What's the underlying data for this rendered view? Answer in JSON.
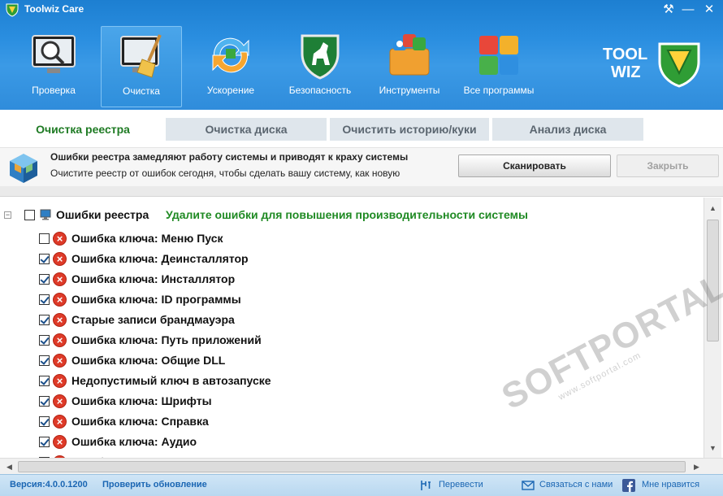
{
  "window": {
    "title": "Toolwiz Care",
    "settings_glyph": "⚒",
    "minimize_glyph": "―",
    "close_glyph": "✕"
  },
  "toolbar": {
    "items": [
      {
        "label": "Проверка",
        "icon": "magnifier-monitor-icon"
      },
      {
        "label": "Очистка",
        "icon": "broom-monitor-icon",
        "active": true
      },
      {
        "label": "Ускорение",
        "icon": "speed-arrows-icon"
      },
      {
        "label": "Безопасность",
        "icon": "shield-horse-icon"
      },
      {
        "label": "Инструменты",
        "icon": "toolbox-icon"
      },
      {
        "label": "Все программы",
        "icon": "apps-grid-icon"
      }
    ]
  },
  "brand": {
    "line1": "TOOL",
    "line2": "WIZ"
  },
  "subtabs": [
    {
      "label": "Очистка реестра",
      "active": true
    },
    {
      "label": "Очистка диска",
      "active": false
    },
    {
      "label": "Очистить историю/куки",
      "active": false
    },
    {
      "label": "Анализ диска",
      "active": false
    }
  ],
  "info": {
    "title": "Ошибки реестра замедляют работу системы и приводят к краху системы",
    "subtitle": "Очистите реестр от ошибок сегодня, чтобы сделать вашу систему, как новую",
    "scan_button": "Сканировать",
    "close_button": "Закрыть"
  },
  "tree": {
    "expander": "−",
    "root_label": "Ошибки реестра",
    "root_hint": "Удалите ошибки для повышения производительности системы",
    "root_checked": false,
    "error_glyph": "×",
    "items": [
      {
        "label": "Ошибка ключа: Меню Пуск",
        "checked": false
      },
      {
        "label": "Ошибка ключа: Деинсталлятор",
        "checked": true
      },
      {
        "label": "Ошибка ключа: Инсталлятор",
        "checked": true
      },
      {
        "label": "Ошибка ключа: ID программы",
        "checked": true
      },
      {
        "label": "Старые записи брандмауэра",
        "checked": true
      },
      {
        "label": "Ошибка ключа: Путь приложений",
        "checked": true
      },
      {
        "label": "Ошибка ключа: Общие DLL",
        "checked": true
      },
      {
        "label": "Недопустимый ключ в автозапуске",
        "checked": true
      },
      {
        "label": "Ошибка ключа: Шрифты",
        "checked": true
      },
      {
        "label": "Ошибка ключа: Справка",
        "checked": true
      },
      {
        "label": "Ошибка ключа: Аудио",
        "checked": true
      },
      {
        "label": "Ошибка ключа: ActiveX и COM",
        "checked": true
      }
    ]
  },
  "scroll": {
    "up": "▲",
    "down": "▼",
    "left": "◀",
    "right": "▶"
  },
  "status": {
    "version": "Версия:4.0.0.1200",
    "update": "Проверить обновление",
    "translate": "Перевести",
    "contact": "Связаться с нами",
    "like": "Мне нравится"
  },
  "watermark": {
    "text": "SOFTPORTAL",
    "sub": "www.softportal.com"
  },
  "colors": {
    "header_blue": "#2a8ee0",
    "active_green": "#1f7b24",
    "hint_green": "#1f8a23",
    "error_red": "#de3a28",
    "link_blue": "#1a66b3"
  }
}
